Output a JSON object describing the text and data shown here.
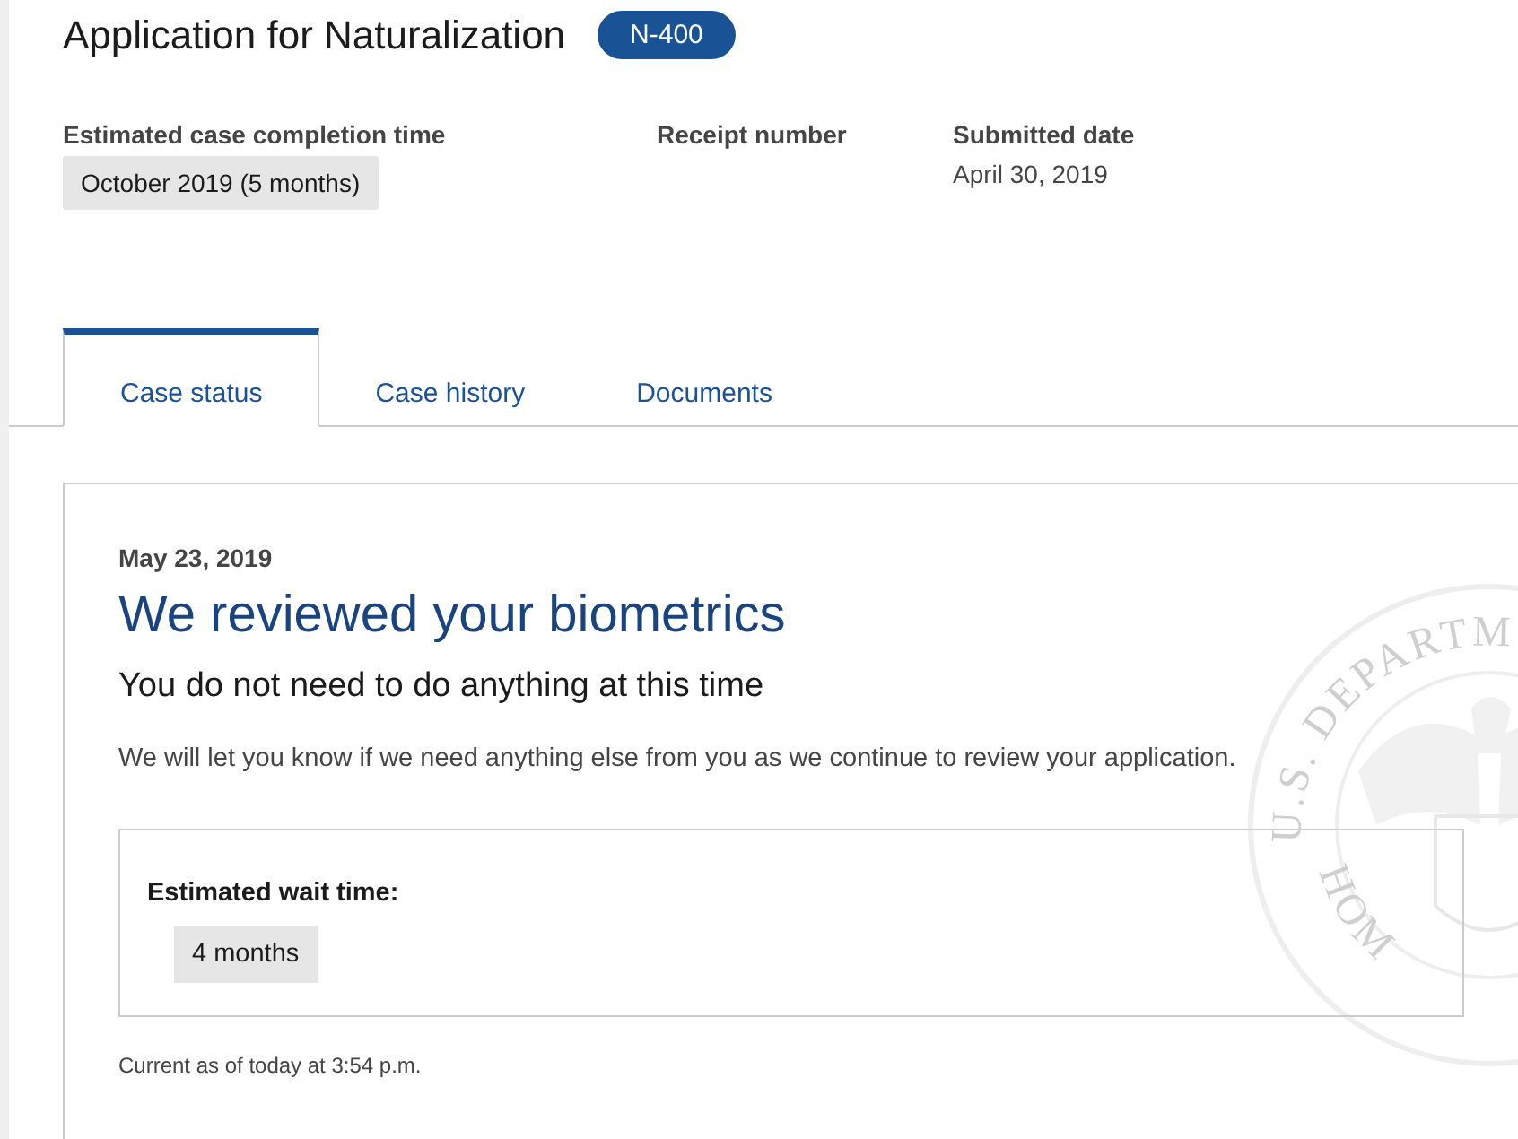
{
  "header": {
    "title": "Application for Naturalization",
    "form_badge": "N-400"
  },
  "details": [
    {
      "label": "Estimated case completion time",
      "value": "October 2019 (5 months)",
      "kind": "pill"
    },
    {
      "label": "Receipt number",
      "kind": "empty"
    },
    {
      "label": "Submitted date",
      "value": "April 30, 2019",
      "kind": "plain"
    }
  ],
  "tabs": [
    {
      "label": "Case status",
      "selected": true
    },
    {
      "label": "Case history",
      "selected": false
    },
    {
      "label": "Documents",
      "selected": false
    }
  ],
  "status_card": {
    "date": "May 23, 2019",
    "heading": "We reviewed your biometrics",
    "subheading": "You do not need to do anything at this time",
    "message": "We will let you know if we need anything else from you as we continue to review your application.",
    "wait_label": "Estimated wait time:",
    "wait_value": "4 months",
    "updated": "Current as of today at 3:54 p.m.",
    "seal_text_top": "U.S. DEPARTM",
    "seal_text_bottom": "HOM"
  }
}
